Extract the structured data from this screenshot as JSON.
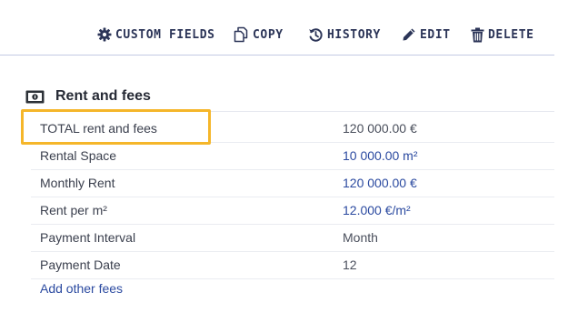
{
  "toolbar": {
    "custom_fields": {
      "label": "CUSTOM FIELDS",
      "icon": "gear-icon"
    },
    "copy": {
      "label": "COPY",
      "icon": "copy-icon"
    },
    "history": {
      "label": "HISTORY",
      "icon": "history-icon"
    },
    "edit": {
      "label": "EDIT",
      "icon": "pencil-icon"
    },
    "delete": {
      "label": "DELETE",
      "icon": "trash-icon"
    },
    "text_color": "#2c3558"
  },
  "section": {
    "title": "Rent and fees",
    "icon": "banknote-icon"
  },
  "rows": [
    {
      "label": "TOTAL rent and fees",
      "value": "120 000.00 €",
      "highlighted": true
    },
    {
      "label": "Rental Space",
      "value": "10 000.00 m²"
    },
    {
      "label": "Monthly Rent",
      "value": "120 000.00 €"
    },
    {
      "label": "Rent per m²",
      "value": "12.000 €/m²"
    },
    {
      "label": "Payment Interval",
      "value": "Month"
    },
    {
      "label": "Payment Date",
      "value": "12"
    }
  ],
  "add_fees": {
    "label": "Add other fees"
  },
  "colors": {
    "link": "#2b4aa0",
    "highlight": "#f5b62a",
    "divider": "#c3c9e3"
  }
}
